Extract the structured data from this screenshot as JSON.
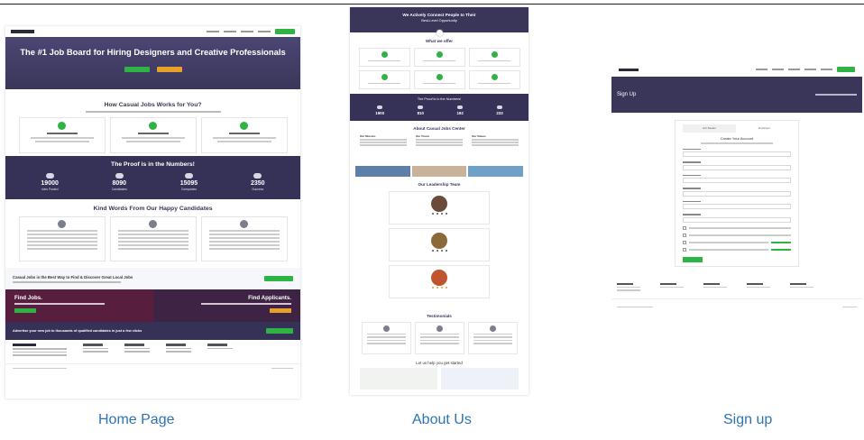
{
  "captions": {
    "home": "Home Page",
    "about": "About Us",
    "signup": "Sign up"
  },
  "home": {
    "hero_title": "The #1 Job Board for Hiring Designers and Creative Professionals",
    "how_title": "How Casual Jobs Works for You?",
    "numbers_title": "The Proof is in the Numbers!",
    "stats": [
      {
        "value": "19000",
        "label": "Jobs Posted"
      },
      {
        "value": "8090",
        "label": "Candidates"
      },
      {
        "value": "15095",
        "label": "Companies"
      },
      {
        "value": "2350",
        "label": "Success"
      }
    ],
    "testimonials_title": "Kind Words From Our Happy Candidates",
    "best_way": "Casual Jobs is the Best Way to Find & Discover Great Local Jobs",
    "find_jobs": "Find Jobs.",
    "find_applicants": "Find Applicants.",
    "advertise": "Advertise your new job to thousands of qualified candidates in just a few clicks"
  },
  "about": {
    "hero_title": "We Actively Connect People to Their",
    "hero_title2": "Best-Level Opportunity",
    "offer_title": "What we offer",
    "proof_title": "The Proof is in the Numbers!",
    "stats": [
      "1900",
      "810",
      "192",
      "233"
    ],
    "about_title": "About Casual Jobs Center",
    "about_cols": [
      "Our Mission",
      "Our Vision",
      "Our Values"
    ],
    "team_title": "Our Leadership Team",
    "testimonials_title": "Testimonials",
    "start_title": "Let us help you get started"
  },
  "signup": {
    "hero_title": "Sign Up",
    "tabs": [
      "Job Seeker",
      "Employer"
    ],
    "form_title": "Create Your Account"
  },
  "colors": {
    "brand_dark": "#3a3659",
    "accent_green": "#2fb344",
    "accent_orange": "#e7a12b",
    "caption_blue": "#2e74b5"
  }
}
